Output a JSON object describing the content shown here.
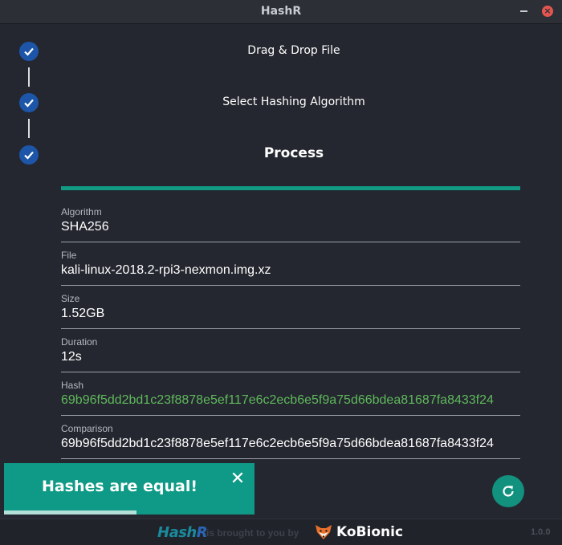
{
  "window": {
    "title": "HashR",
    "minimize_icon": "minimize-icon",
    "close_icon": "close-icon",
    "close_glyph": "×"
  },
  "steps": [
    {
      "label": "Drag & Drop File",
      "icon": "checkmark-icon",
      "status": "done"
    },
    {
      "label": "Select Hashing Algorithm",
      "icon": "checkmark-icon",
      "status": "done"
    },
    {
      "label": "Process",
      "icon": "checkmark-icon",
      "status": "active"
    }
  ],
  "progress": {
    "percent": 100,
    "color": "#129a85"
  },
  "fields": {
    "algorithm": {
      "label": "Algorithm",
      "value": "SHA256"
    },
    "file": {
      "label": "File",
      "value": "kali-linux-2018.2-rpi3-nexmon.img.xz"
    },
    "size": {
      "label": "Size",
      "value": "1.52GB"
    },
    "duration": {
      "label": "Duration",
      "value": "12s"
    },
    "hash": {
      "label": "Hash",
      "value": "69b96f5dd2bd1c23f8878e5ef117e6c2ecb6e5f9a75d66bdea81687fa8433f24"
    },
    "comparison": {
      "label": "Comparison",
      "value": "69b96f5dd2bd1c23f8878e5ef117e6c2ecb6e5f9a75d66bdea81687fa8433f24"
    }
  },
  "snackbar": {
    "message": "Hashes are equal!",
    "close_glyph": "✕",
    "timer_remaining": 0.53
  },
  "refresh": {
    "icon": "refresh-icon"
  },
  "footer": {
    "brand_prefix": "Hash",
    "brand_suffix": "R",
    "tagline": "is brought to you by",
    "company": "KoBionic",
    "company_icon": "fox-icon",
    "version": "1.0.0"
  },
  "colors": {
    "accent": "#129a85",
    "step_icon": "#1d55a8",
    "hash_match": "#5fb85c",
    "background": "#24272f"
  }
}
